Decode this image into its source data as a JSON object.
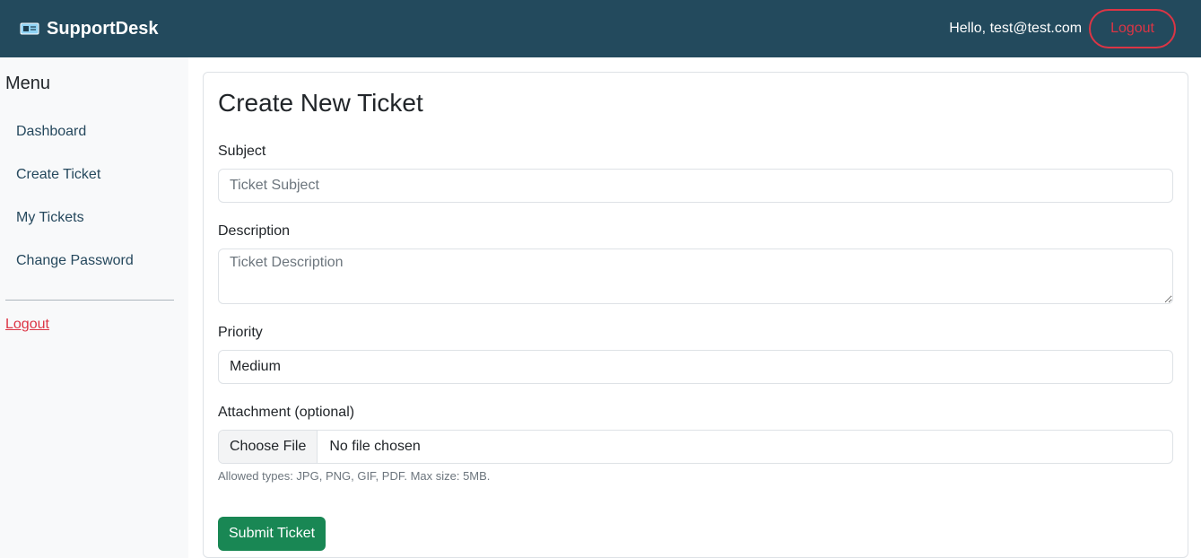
{
  "header": {
    "brand": "SupportDesk",
    "greeting": "Hello, test@test.com",
    "logout_label": "Logout",
    "brand_color": "#234a5d"
  },
  "sidebar": {
    "title": "Menu",
    "items": [
      {
        "label": "Dashboard"
      },
      {
        "label": "Create Ticket"
      },
      {
        "label": "My Tickets"
      },
      {
        "label": "Change Password"
      }
    ],
    "logout_label": "Logout"
  },
  "form": {
    "title": "Create New Ticket",
    "subject": {
      "label": "Subject",
      "placeholder": "Ticket Subject",
      "value": ""
    },
    "description": {
      "label": "Description",
      "placeholder": "Ticket Description",
      "value": ""
    },
    "priority": {
      "label": "Priority",
      "value": "Medium"
    },
    "attachment": {
      "label": "Attachment (optional)",
      "button_label": "Choose File",
      "status": "No file chosen",
      "help": "Allowed types: JPG, PNG, GIF, PDF. Max size: 5MB."
    },
    "submit_label": "Submit Ticket",
    "submit_color": "#198754"
  }
}
